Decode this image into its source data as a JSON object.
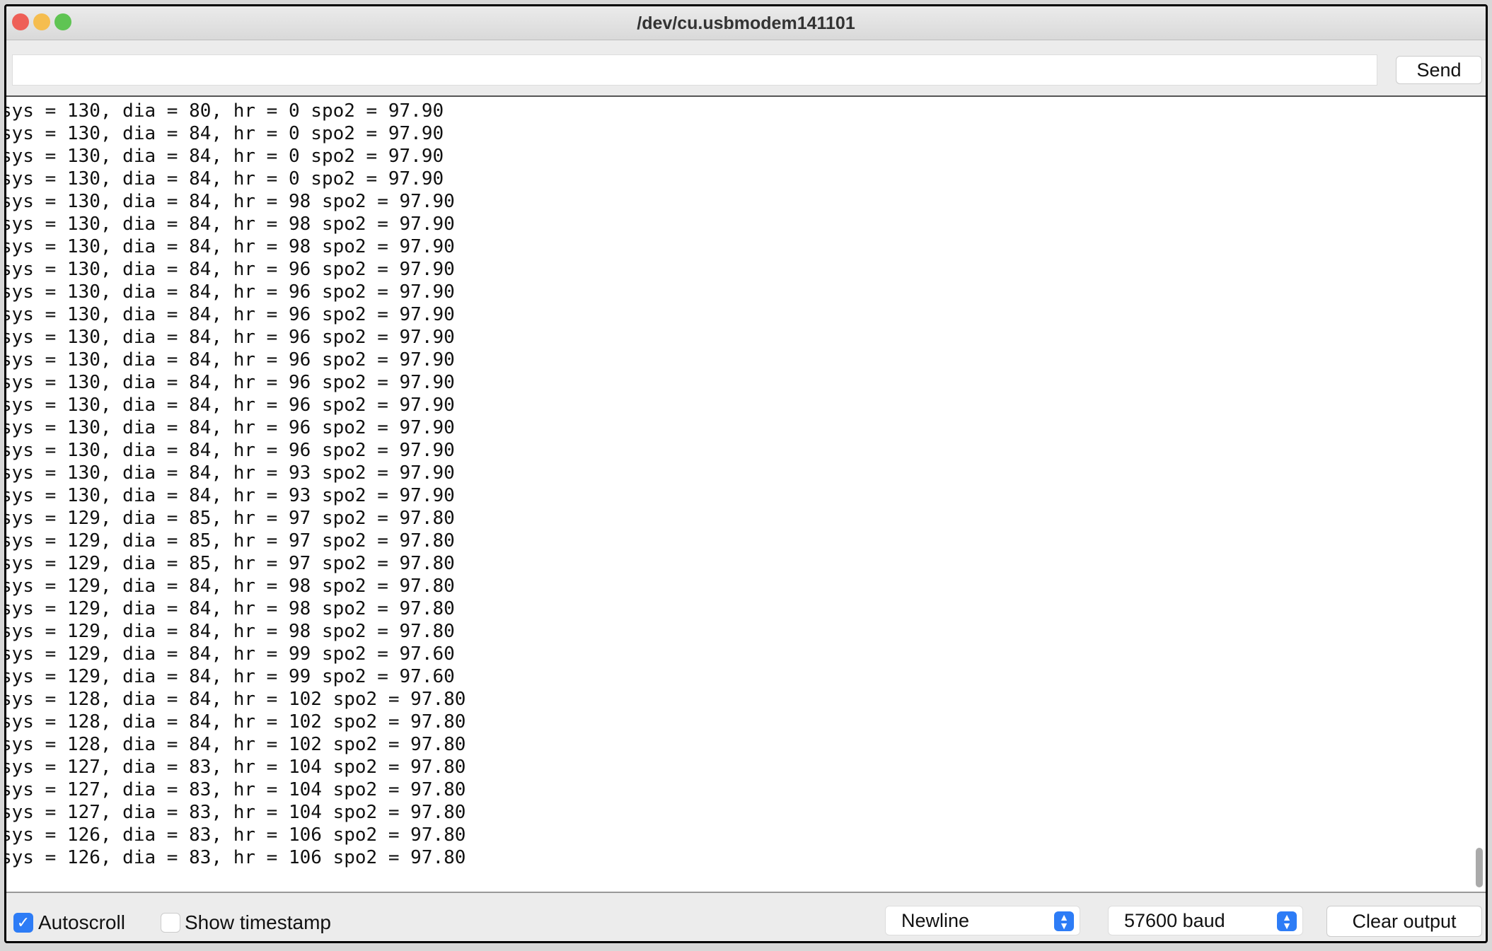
{
  "window": {
    "title": "/dev/cu.usbmodem141101"
  },
  "input": {
    "value": "",
    "send_label": "Send"
  },
  "output": {
    "lines": [
      "sys = 130, dia = 80, hr = 0 spo2 = 97.90",
      "sys = 130, dia = 84, hr = 0 spo2 = 97.90",
      "sys = 130, dia = 84, hr = 0 spo2 = 97.90",
      "sys = 130, dia = 84, hr = 0 spo2 = 97.90",
      "sys = 130, dia = 84, hr = 98 spo2 = 97.90",
      "sys = 130, dia = 84, hr = 98 spo2 = 97.90",
      "sys = 130, dia = 84, hr = 98 spo2 = 97.90",
      "sys = 130, dia = 84, hr = 96 spo2 = 97.90",
      "sys = 130, dia = 84, hr = 96 spo2 = 97.90",
      "sys = 130, dia = 84, hr = 96 spo2 = 97.90",
      "sys = 130, dia = 84, hr = 96 spo2 = 97.90",
      "sys = 130, dia = 84, hr = 96 spo2 = 97.90",
      "sys = 130, dia = 84, hr = 96 spo2 = 97.90",
      "sys = 130, dia = 84, hr = 96 spo2 = 97.90",
      "sys = 130, dia = 84, hr = 96 spo2 = 97.90",
      "sys = 130, dia = 84, hr = 96 spo2 = 97.90",
      "sys = 130, dia = 84, hr = 93 spo2 = 97.90",
      "sys = 130, dia = 84, hr = 93 spo2 = 97.90",
      "sys = 129, dia = 85, hr = 97 spo2 = 97.80",
      "sys = 129, dia = 85, hr = 97 spo2 = 97.80",
      "sys = 129, dia = 85, hr = 97 spo2 = 97.80",
      "sys = 129, dia = 84, hr = 98 spo2 = 97.80",
      "sys = 129, dia = 84, hr = 98 spo2 = 97.80",
      "sys = 129, dia = 84, hr = 98 spo2 = 97.80",
      "sys = 129, dia = 84, hr = 99 spo2 = 97.60",
      "sys = 129, dia = 84, hr = 99 spo2 = 97.60",
      "sys = 128, dia = 84, hr = 102 spo2 = 97.80",
      "sys = 128, dia = 84, hr = 102 spo2 = 97.80",
      "sys = 128, dia = 84, hr = 102 spo2 = 97.80",
      "sys = 127, dia = 83, hr = 104 spo2 = 97.80",
      "sys = 127, dia = 83, hr = 104 spo2 = 97.80",
      "sys = 127, dia = 83, hr = 104 spo2 = 97.80",
      "sys = 126, dia = 83, hr = 106 spo2 = 97.80",
      "sys = 126, dia = 83, hr = 106 spo2 = 97.80"
    ]
  },
  "footer": {
    "autoscroll_label": "Autoscroll",
    "autoscroll_checked": true,
    "timestamp_label": "Show timestamp",
    "timestamp_checked": false,
    "line_ending": "Newline",
    "baud": "57600 baud",
    "clear_label": "Clear output"
  },
  "colors": {
    "accent": "#2d7cf6",
    "close": "#ee5f57",
    "minimize": "#f5bd4f",
    "zoom": "#5fc453"
  }
}
